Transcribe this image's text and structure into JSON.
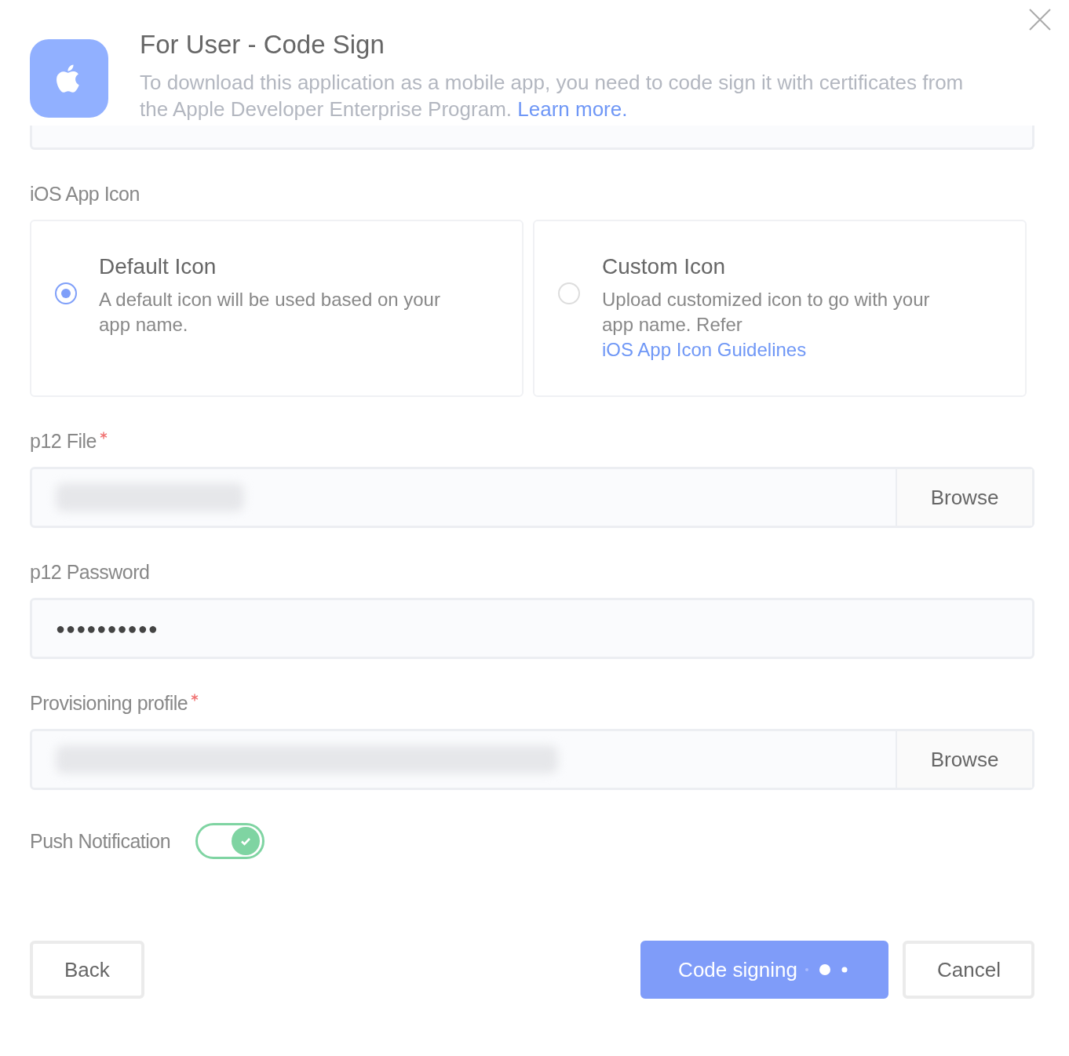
{
  "dialog": {
    "title": "For User - Code Sign",
    "description": "To download this application as a mobile app, you need to code sign it with certificates from the Apple Developer Enterprise Program.",
    "description_link": "Learn more."
  },
  "icon_section": {
    "label": "iOS App Icon",
    "options": [
      {
        "title": "Default Icon",
        "text": "A default icon will be used based on your app name.",
        "selected": true
      },
      {
        "title": "Custom Icon",
        "text": "Upload customized icon to go with your app name. Refer",
        "link": "iOS App Icon Guidelines",
        "selected": false
      }
    ]
  },
  "p12_file": {
    "label": "p12 File",
    "required": true,
    "button": "Browse"
  },
  "p12_password": {
    "label": "p12 Password",
    "value": "●●●●●●●●●●"
  },
  "provisioning_profile": {
    "label": "Provisioning profile",
    "required": true,
    "button": "Browse"
  },
  "push_notification": {
    "label": "Push Notification",
    "on": true
  },
  "buttons": {
    "back": "Back",
    "submit": {
      "label": "Code signing",
      "loading": true
    },
    "cancel": "Cancel"
  }
}
